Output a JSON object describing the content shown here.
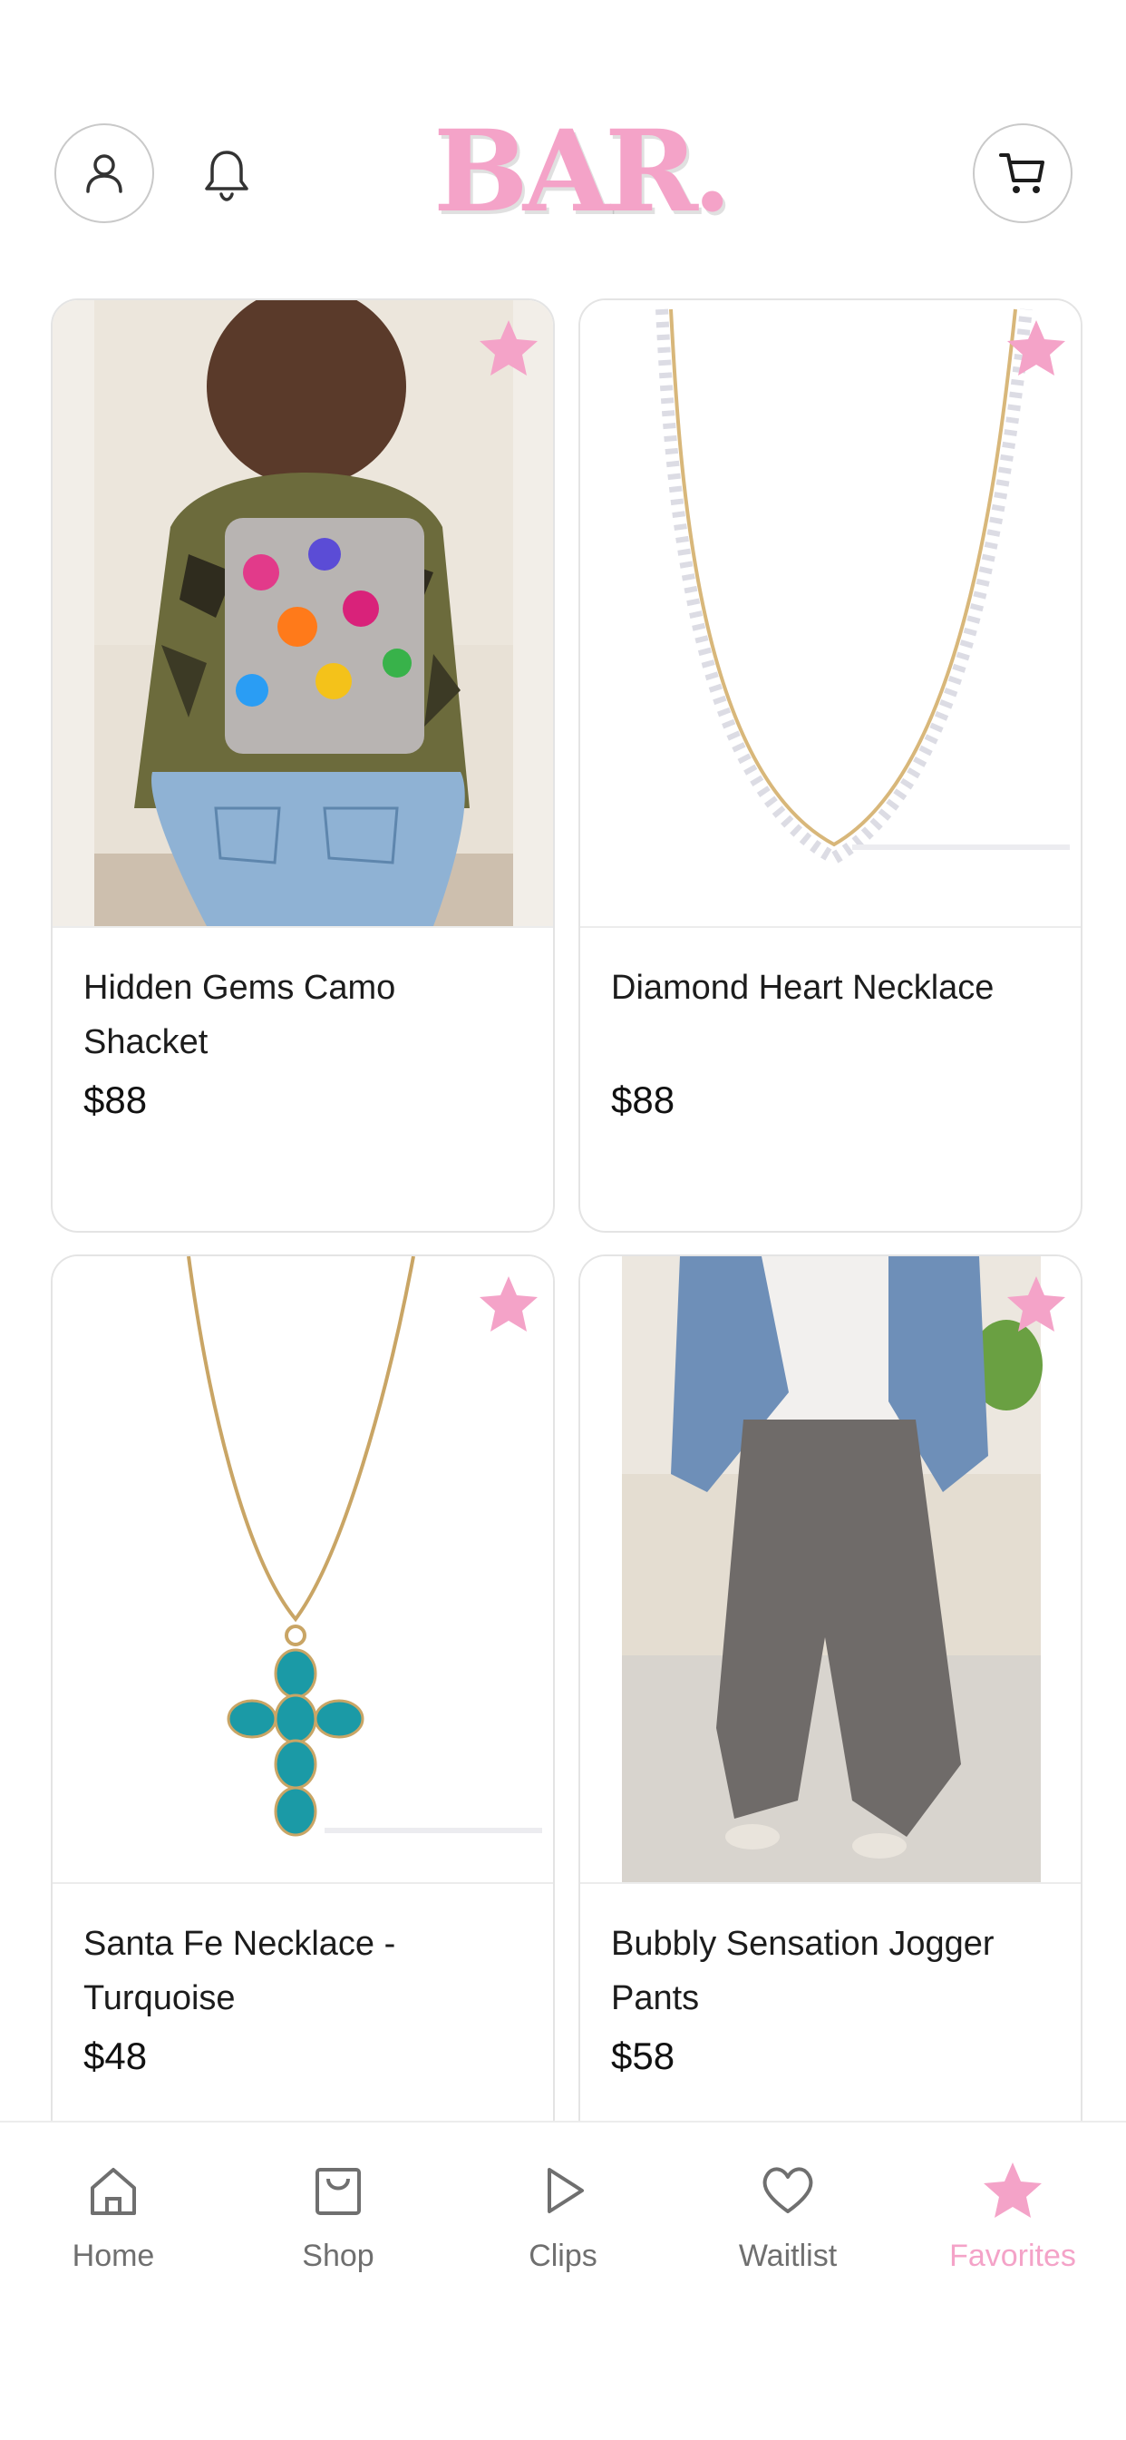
{
  "header": {
    "logo": "BAR.",
    "account_icon": "user-icon",
    "notifications_icon": "bell-icon",
    "cart_icon": "cart-icon"
  },
  "products": [
    {
      "name": "Hidden Gems Camo Shacket",
      "price": "$88",
      "favorite_icon": "star-icon"
    },
    {
      "name": "Diamond Heart Necklace",
      "price": "$88",
      "favorite_icon": "star-icon"
    },
    {
      "name": "Santa Fe Necklace - Turquoise",
      "price": "$48",
      "favorite_icon": "star-icon"
    },
    {
      "name": "Bubbly Sensation Jogger Pants",
      "price": "$58",
      "favorite_icon": "star-icon"
    }
  ],
  "bottom_nav": {
    "items": [
      {
        "label": "Home",
        "icon": "home-icon"
      },
      {
        "label": "Shop",
        "icon": "shopping-bag-icon"
      },
      {
        "label": "Clips",
        "icon": "play-icon"
      },
      {
        "label": "Waitlist",
        "icon": "heart-icon"
      },
      {
        "label": "Favorites",
        "icon": "star-icon",
        "active": true
      }
    ]
  },
  "colors": {
    "accent_pink": "#f4a3c8",
    "nav_inactive": "#6f6f6f",
    "card_border": "#e4e4e4"
  }
}
